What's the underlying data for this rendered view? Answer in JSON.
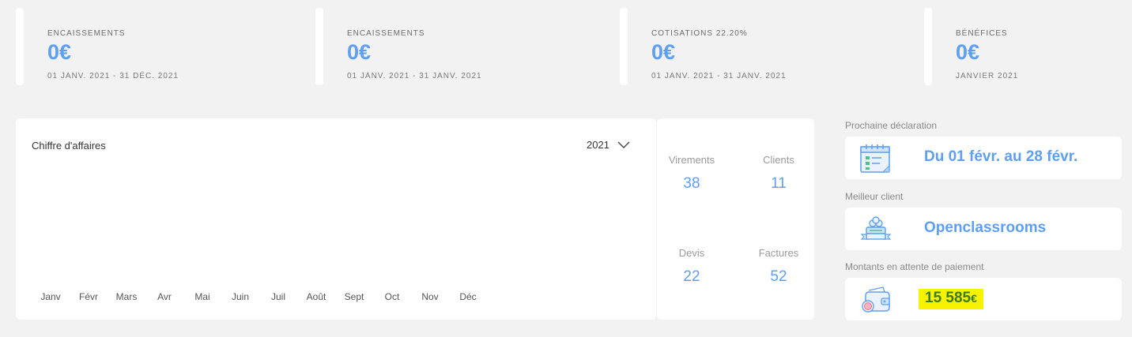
{
  "stats": [
    {
      "label": "ENCAISSEMENTS",
      "value": "0€",
      "period": "01 JANV. 2021 - 31 DÉC. 2021"
    },
    {
      "label": "ENCAISSEMENTS",
      "value": "0€",
      "period": "01 JANV. 2021 - 31 JANV. 2021"
    },
    {
      "label": "COTISATIONS 22.20%",
      "value": "0€",
      "period": "01 JANV. 2021 - 31 JANV. 2021"
    },
    {
      "label": "BÉNÉFICES",
      "value": "0€",
      "period": "JANVIER 2021"
    }
  ],
  "revenue_chart": {
    "title": "Chiffre d'affaires",
    "year": "2021",
    "months": [
      "Janv",
      "Févr",
      "Mars",
      "Avr",
      "Mai",
      "Juin",
      "Juil",
      "Août",
      "Sept",
      "Oct",
      "Nov",
      "Déc"
    ]
  },
  "metrics": [
    {
      "label": "Virements",
      "value": "38"
    },
    {
      "label": "Clients",
      "value": "11"
    },
    {
      "label": "Devis",
      "value": "22"
    },
    {
      "label": "Factures",
      "value": "52"
    }
  ],
  "sidebar": {
    "next_declaration": {
      "label": "Prochaine déclaration",
      "text": "Du 01 févr. au 28 févr.",
      "icon": "calendar-icon"
    },
    "best_client": {
      "label": "Meilleur client",
      "text": "Openclassrooms",
      "icon": "trophy-icon"
    },
    "pending_amount": {
      "label": "Montants en attente de paiement",
      "amount": "15 585",
      "unit": "€",
      "icon": "wallet-icon"
    }
  },
  "colors": {
    "accent": "#5e9ff1",
    "highlight": "#f7f300",
    "highlight_text": "#3b7d1a"
  }
}
